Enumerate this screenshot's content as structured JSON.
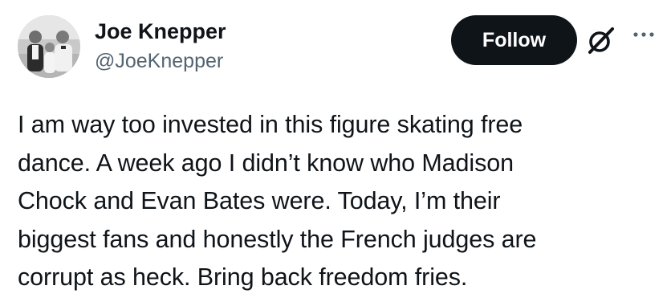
{
  "author": {
    "name": "Joe Knepper",
    "handle": "@JoeKnepper"
  },
  "actions": {
    "follow_label": "Follow"
  },
  "icons": {
    "grok": "grok-icon",
    "more": "more-horizontal-icon"
  },
  "tweet": {
    "text": "I am way too invested in this figure skating free\ndance. A week ago I didn’t know who Madison\nChock and Evan Bates were. Today, I’m their\nbiggest fans and honestly the French judges are\ncorrupt as heck. Bring back freedom fries."
  },
  "colors": {
    "text_primary": "#0f1419",
    "text_secondary": "#536471",
    "button_bg": "#0f1419",
    "button_text": "#ffffff"
  }
}
